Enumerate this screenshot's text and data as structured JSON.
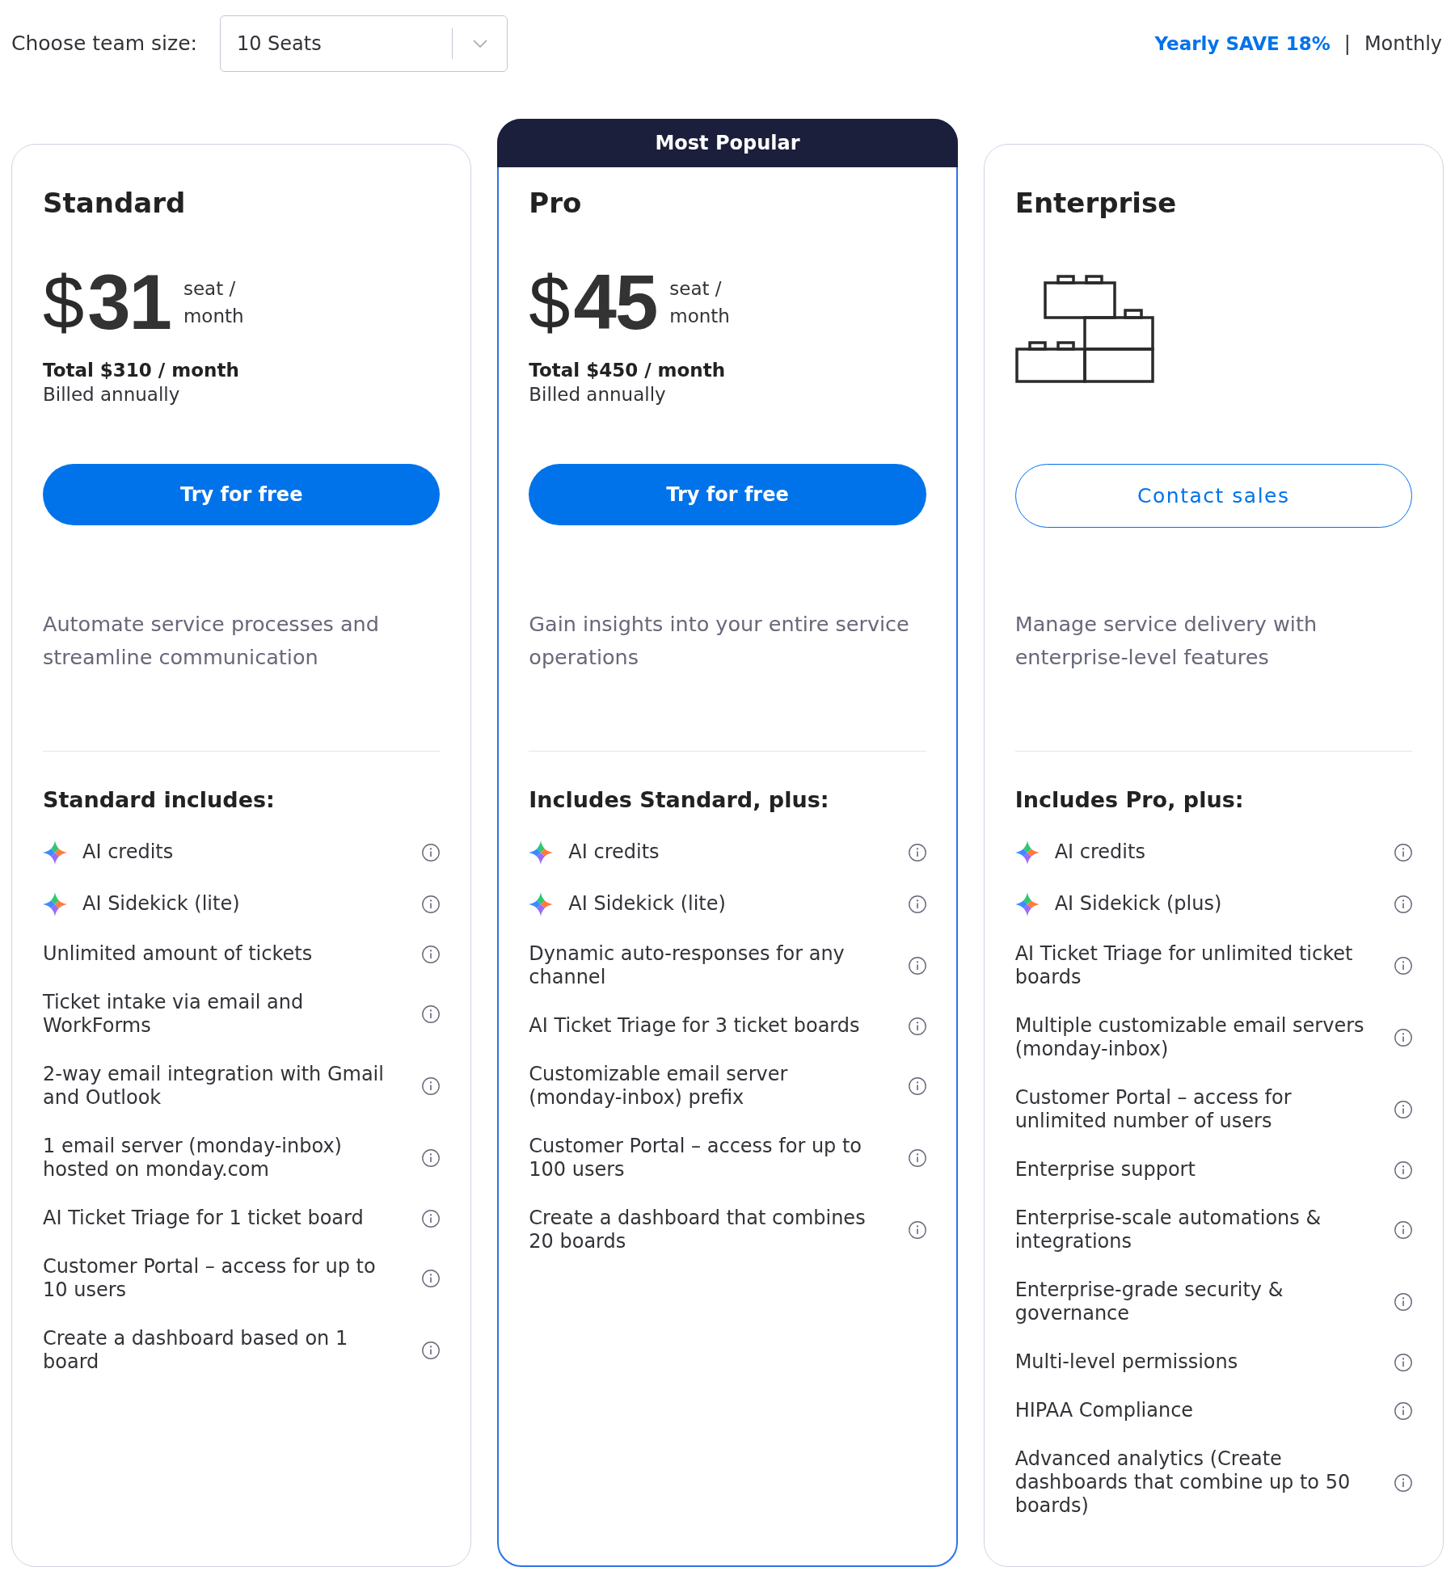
{
  "team_size": {
    "label": "Choose team size:",
    "value": "10 Seats"
  },
  "billing": {
    "options": [
      {
        "label": "Yearly SAVE 18%",
        "selected": true
      },
      {
        "label": "Monthly",
        "selected": false
      }
    ],
    "separator": "|"
  },
  "plans": [
    {
      "name": "Standard",
      "kind": "priced",
      "featured": false,
      "price": {
        "currency": "$",
        "amount": "31",
        "unit": "seat / month"
      },
      "total": "Total $310 / month",
      "billing_note": "Billed annually",
      "button": {
        "kind": "filled",
        "label": "Try for free"
      },
      "description": "Automate service processes and streamline communication",
      "includes_title": "Standard includes:",
      "features": [
        {
          "kind": "ai",
          "text": "AI credits"
        },
        {
          "kind": "ai",
          "text": "AI Sidekick (lite)"
        },
        {
          "kind": "plain",
          "text": "Unlimited amount of tickets"
        },
        {
          "kind": "plain",
          "text": "Ticket intake via email and WorkForms"
        },
        {
          "kind": "plain",
          "text": "2-way email integration with Gmail and Outlook"
        },
        {
          "kind": "plain",
          "text": "1 email server (monday-inbox) hosted on monday.com"
        },
        {
          "kind": "plain",
          "text": "AI Ticket Triage for 1 ticket board"
        },
        {
          "kind": "plain",
          "text": "Customer Portal – access for up to 10 users"
        },
        {
          "kind": "plain",
          "text": "Create a dashboard based on 1 board"
        }
      ]
    },
    {
      "name": "Pro",
      "kind": "priced",
      "featured": true,
      "badge": "Most Popular",
      "price": {
        "currency": "$",
        "amount": "45",
        "unit": "seat / month"
      },
      "total": "Total $450 / month",
      "billing_note": "Billed annually",
      "button": {
        "kind": "filled",
        "label": "Try for free"
      },
      "description": "Gain insights into your entire service operations",
      "includes_title": "Includes Standard, plus:",
      "features": [
        {
          "kind": "ai",
          "text": "AI credits"
        },
        {
          "kind": "ai",
          "text": "AI Sidekick (lite)"
        },
        {
          "kind": "plain",
          "text": "Dynamic auto-responses for any channel"
        },
        {
          "kind": "plain",
          "text": "AI Ticket Triage for 3 ticket boards"
        },
        {
          "kind": "plain",
          "text": "Customizable email server (monday-inbox) prefix"
        },
        {
          "kind": "plain",
          "text": "Customer Portal – access for up to 100 users"
        },
        {
          "kind": "plain",
          "text": "Create a dashboard that combines 20 boards"
        }
      ]
    },
    {
      "name": "Enterprise",
      "kind": "custom",
      "featured": false,
      "button": {
        "kind": "outline",
        "label": "Contact sales"
      },
      "description": "Manage service delivery with enterprise-level features",
      "includes_title": "Includes Pro, plus:",
      "features": [
        {
          "kind": "ai",
          "text": "AI credits"
        },
        {
          "kind": "ai",
          "text": "AI Sidekick (plus)"
        },
        {
          "kind": "plain",
          "text": "AI Ticket Triage for unlimited ticket boards"
        },
        {
          "kind": "plain",
          "text": "Multiple customizable email servers (monday-inbox)"
        },
        {
          "kind": "plain",
          "text": "Customer Portal – access for unlimited number of users"
        },
        {
          "kind": "plain",
          "text": "Enterprise support"
        },
        {
          "kind": "plain",
          "text": "Enterprise-scale automations & integrations"
        },
        {
          "kind": "plain",
          "text": "Enterprise-grade security & governance"
        },
        {
          "kind": "plain",
          "text": "Multi-level permissions"
        },
        {
          "kind": "plain",
          "text": "HIPAA Compliance"
        },
        {
          "kind": "plain",
          "text": "Advanced analytics (Create dashboards that combine up to 50 boards)"
        }
      ]
    }
  ]
}
